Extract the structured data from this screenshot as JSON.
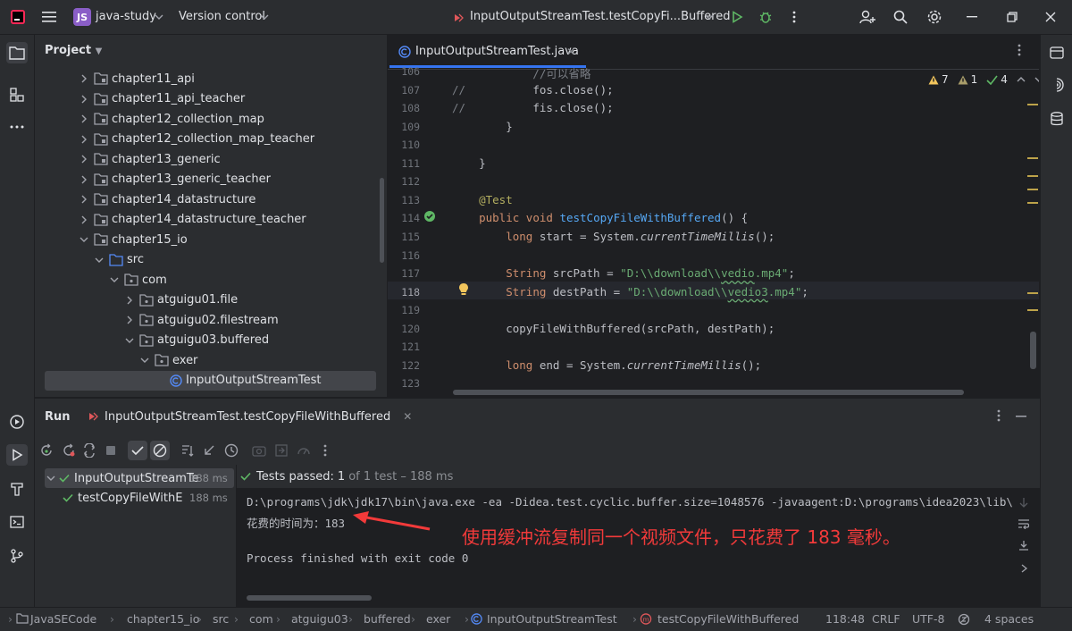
{
  "titlebar": {
    "project_badge": "JS",
    "project_name": "java-study",
    "vcs_label": "Version control",
    "run_config": "InputOutputStreamTest.testCopyFi...Buffered"
  },
  "project_panel": {
    "title": "Project",
    "items": [
      {
        "label": "chapter11_api",
        "depth": 0,
        "expanded": false,
        "kind": "module"
      },
      {
        "label": "chapter11_api_teacher",
        "depth": 0,
        "expanded": false,
        "kind": "module"
      },
      {
        "label": "chapter12_collection_map",
        "depth": 0,
        "expanded": false,
        "kind": "module"
      },
      {
        "label": "chapter12_collection_map_teacher",
        "depth": 0,
        "expanded": false,
        "kind": "module"
      },
      {
        "label": "chapter13_generic",
        "depth": 0,
        "expanded": false,
        "kind": "module"
      },
      {
        "label": "chapter13_generic_teacher",
        "depth": 0,
        "expanded": false,
        "kind": "module"
      },
      {
        "label": "chapter14_datastructure",
        "depth": 0,
        "expanded": false,
        "kind": "module"
      },
      {
        "label": "chapter14_datastructure_teacher",
        "depth": 0,
        "expanded": false,
        "kind": "module"
      },
      {
        "label": "chapter15_io",
        "depth": 0,
        "expanded": true,
        "kind": "module"
      },
      {
        "label": "src",
        "depth": 1,
        "expanded": true,
        "kind": "source"
      },
      {
        "label": "com",
        "depth": 2,
        "expanded": true,
        "kind": "package"
      },
      {
        "label": "atguigu01.file",
        "depth": 3,
        "expanded": false,
        "kind": "package"
      },
      {
        "label": "atguigu02.filestream",
        "depth": 3,
        "expanded": false,
        "kind": "package"
      },
      {
        "label": "atguigu03.buffered",
        "depth": 3,
        "expanded": true,
        "kind": "package"
      },
      {
        "label": "exer",
        "depth": 4,
        "expanded": true,
        "kind": "package"
      },
      {
        "label": "InputOutputStreamTest",
        "depth": 5,
        "expanded": null,
        "kind": "class",
        "selected": true
      }
    ]
  },
  "editor": {
    "tab_label": "InputOutputStreamTest.java",
    "inspections": {
      "warnings": "7",
      "weak": "1",
      "ok": "4"
    },
    "lines": [
      {
        "n": "106",
        "text": "            //可以省略"
      },
      {
        "n": "107",
        "text": "//          fos.close();"
      },
      {
        "n": "108",
        "text": "//          fis.close();"
      },
      {
        "n": "109",
        "text": "        }"
      },
      {
        "n": "110",
        "text": ""
      },
      {
        "n": "111",
        "text": "    }"
      },
      {
        "n": "112",
        "text": ""
      },
      {
        "n": "113",
        "text": "    @Test"
      },
      {
        "n": "114",
        "text": "    public void testCopyFileWithBuffered() {"
      },
      {
        "n": "115",
        "text": "        long start = System.currentTimeMillis();"
      },
      {
        "n": "116",
        "text": ""
      },
      {
        "n": "117",
        "text": "        String srcPath = \"D:\\\\download\\\\vedio.mp4\";"
      },
      {
        "n": "118",
        "text": "        String destPath = \"D:\\\\download\\\\vedio3.mp4\";"
      },
      {
        "n": "119",
        "text": ""
      },
      {
        "n": "120",
        "text": "        copyFileWithBuffered(srcPath, destPath);"
      },
      {
        "n": "121",
        "text": ""
      },
      {
        "n": "122",
        "text": "        long end = System.currentTimeMillis();"
      },
      {
        "n": "123",
        "text": ""
      }
    ]
  },
  "run": {
    "title": "Run",
    "tab_label": "InputOutputStreamTest.testCopyFileWithBuffered",
    "tests_passed": "Tests passed:",
    "tests_count": "1",
    "tests_detail": "of 1 test – 188 ms",
    "tree": [
      {
        "label": "InputOutputStreamTe",
        "duration": "188 ms"
      },
      {
        "label": "testCopyFileWithE",
        "duration": "188 ms"
      }
    ],
    "console": [
      "D:\\programs\\jdk\\jdk17\\bin\\java.exe -ea -Didea.test.cyclic.buffer.size=1048576 -javaagent:D:\\programs\\idea2023\\lib\\",
      "花费的时间为：183",
      "",
      "Process finished with exit code 0"
    ],
    "annotation": "使用缓冲流复制同一个视频文件，只花费了 183 毫秒。"
  },
  "statusbar": {
    "breadcrumbs": [
      "JavaSECode",
      "chapter15_io",
      "src",
      "com",
      "atguigu03",
      "buffered",
      "exer",
      "InputOutputStreamTest",
      "testCopyFileWithBuffered"
    ],
    "position": "118:48",
    "line_sep": "CRLF",
    "encoding": "UTF-8",
    "indent": "4 spaces"
  },
  "colors": {
    "accent": "#3574f0",
    "pass_green": "#5fb865",
    "annotation_red": "#f23a3a"
  }
}
